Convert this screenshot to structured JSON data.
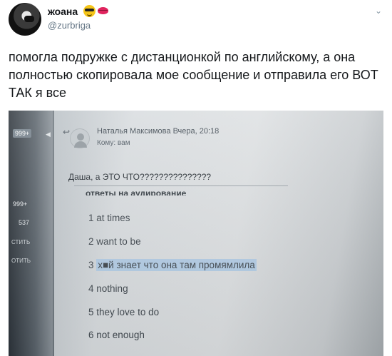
{
  "tweet": {
    "author_name": "жоана",
    "author_handle": "@zurbriga",
    "emojis": [
      "cool-face-emoji",
      "kiss-lips-emoji"
    ],
    "text": "помогла подружке с дистанционкой по английскому, а она полностью скопировала мое сообщение и отправила его ВОТ ТАК я все"
  },
  "photo": {
    "sidebar": {
      "badge_top": "999+",
      "badge_mid": "999+",
      "count": "537",
      "item1": "СТИТЬ",
      "item2": "ОТИТЬ"
    },
    "email": {
      "sender": "Наталья Максимова Вчера, 20:18",
      "recipient": "Кому: вам",
      "message_top": "Даша, а ЭТО ЧТО???????????????",
      "heading_cut": "ответы на аудирование",
      "answers": [
        {
          "num": "1",
          "text": "at times"
        },
        {
          "num": "2",
          "text": "want to be"
        },
        {
          "num": "3",
          "text": "х■й знает что она там промямлила"
        },
        {
          "num": "4",
          "text": "nothing"
        },
        {
          "num": "5",
          "text": "they love to do"
        },
        {
          "num": "6",
          "text": "not enough"
        }
      ]
    }
  },
  "colors": {
    "text_primary": "#14171a",
    "text_secondary": "#657786",
    "highlight": "#b3cde6"
  }
}
